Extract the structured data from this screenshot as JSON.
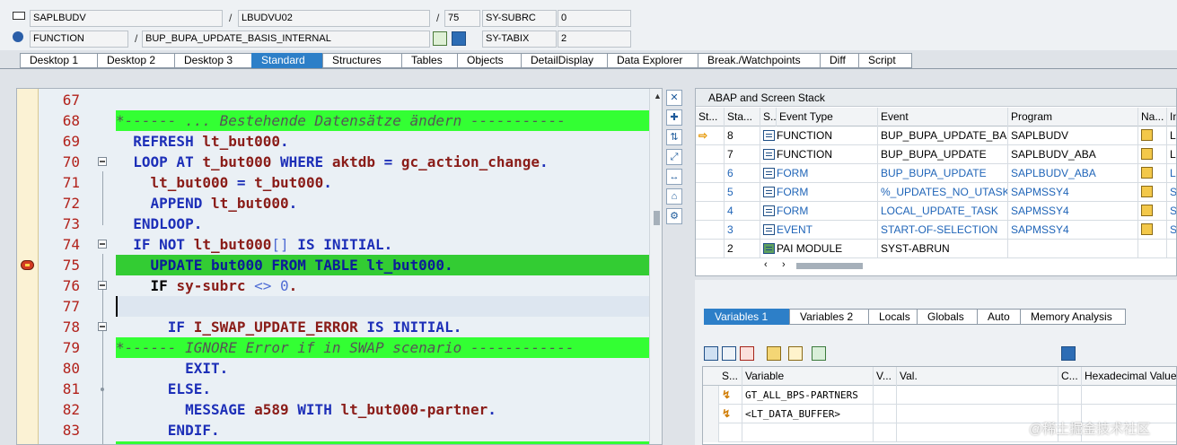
{
  "header": {
    "program": "SAPLBUDV",
    "include": "LBUDVU02",
    "line": "75",
    "subrc_label": "SY-SUBRC",
    "subrc_value": "0",
    "event_type": "FUNCTION",
    "event": "BUP_BUPA_UPDATE_BASIS_INTERNAL",
    "tabix_label": "SY-TABIX",
    "tabix_value": "2",
    "sep": "/"
  },
  "desktop_tabs": [
    "Desktop 1",
    "Desktop 2",
    "Desktop 3",
    "Standard",
    "Structures",
    "Tables",
    "Objects",
    "DetailDisplay",
    "Data Explorer",
    "Break./Watchpoints",
    "Diff",
    "Script"
  ],
  "desktop_tabs_active": "Standard",
  "source": {
    "lines": [
      {
        "no": "67"
      },
      {
        "no": "68",
        "text": "*------ ... Bestehende Datensätze ändern -----------"
      },
      {
        "no": "69",
        "kw1": "REFRESH ",
        "var1": "lt_but000",
        "kw2": "."
      },
      {
        "no": "70",
        "kw1": "LOOP AT ",
        "var1": "t_but000",
        "kw2": " WHERE ",
        "var2": "aktdb",
        "kw3": " = ",
        "var3": "gc_action_change",
        "kw4": "."
      },
      {
        "no": "71",
        "var1": "lt_but000",
        "kw2": " = ",
        "var2": "t_but000",
        "kw3": "."
      },
      {
        "no": "72",
        "kw1": "APPEND ",
        "var1": "lt_but000",
        "kw2": "."
      },
      {
        "no": "73",
        "kw1": "ENDLOOP."
      },
      {
        "no": "74",
        "kw1": "IF NOT ",
        "var1": "lt_but000",
        "n1": "[]",
        "kw2": " IS INITIAL."
      },
      {
        "no": "75",
        "text": "UPDATE but000 FROM TABLE lt_but000."
      },
      {
        "no": "76",
        "kw1": "IF ",
        "var1": "sy-subrc",
        "kw2": " <> ",
        "n1": "0",
        "kw3": "."
      },
      {
        "no": "77"
      },
      {
        "no": "78",
        "kw1": "IF ",
        "var1": "I_SWAP_UPDATE_ERROR",
        "kw2": " IS INITIAL."
      },
      {
        "no": "79",
        "text": "*------ IGNORE Error if in SWAP scenario ------------"
      },
      {
        "no": "80",
        "kw1": "EXIT."
      },
      {
        "no": "81",
        "kw1": "ELSE."
      },
      {
        "no": "82",
        "kw1": "MESSAGE ",
        "var1": "a589",
        "kw2": " WITH ",
        "var2": "lt_but000-partner",
        "kw3": "."
      },
      {
        "no": "83",
        "kw1": "ENDIF."
      }
    ]
  },
  "stack": {
    "title": "ABAP and Screen Stack",
    "columns": [
      "St...",
      "Sta...",
      "S...",
      "Event Type",
      "Event",
      "Program",
      "Na...",
      "In"
    ],
    "rows": [
      {
        "current": true,
        "level": "8",
        "event_type": "FUNCTION",
        "event": "BUP_BUPA_UPDATE_BA...",
        "program": "SAPLBUDV",
        "include": "LE",
        "link": false
      },
      {
        "current": false,
        "level": "7",
        "event_type": "FUNCTION",
        "event": "BUP_BUPA_UPDATE",
        "program": "SAPLBUDV_ABA",
        "include": "LE",
        "link": false
      },
      {
        "current": false,
        "level": "6",
        "event_type": "FORM",
        "event": "BUP_BUPA_UPDATE",
        "program": "SAPLBUDV_ABA",
        "include": "LE",
        "link": true
      },
      {
        "current": false,
        "level": "5",
        "event_type": "FORM",
        "event": "%_UPDATES_NO_UTASK",
        "program": "SAPMSSY4",
        "include": "SA",
        "link": true
      },
      {
        "current": false,
        "level": "4",
        "event_type": "FORM",
        "event": "LOCAL_UPDATE_TASK",
        "program": "SAPMSSY4",
        "include": "SA",
        "link": true
      },
      {
        "current": false,
        "level": "3",
        "event_type": "EVENT",
        "event": "START-OF-SELECTION",
        "program": "SAPMSSY4",
        "include": "SA",
        "link": true
      },
      {
        "current": false,
        "level": "2",
        "event_type": "PAI MODULE",
        "event": "SYST-ABRUN",
        "program": "",
        "include": "",
        "link": false
      }
    ]
  },
  "variables": {
    "tabs": [
      "Variables 1",
      "Variables 2",
      "Locals",
      "Globals",
      "Auto",
      "Memory Analysis"
    ],
    "active": "Variables 1",
    "columns": [
      "S...",
      "Variable",
      "V...",
      "Val.",
      "C...",
      "Hexadecimal Value"
    ],
    "rows": [
      {
        "name": "GT_ALL_BPS-PARTNERS",
        "value": "",
        "hex": ""
      },
      {
        "name": "<LT_DATA_BUFFER>",
        "value": "",
        "hex": ""
      }
    ]
  },
  "watermark": "@稀土掘金技术社区",
  "colors": {
    "accent": "#2d7fc8",
    "current_line": "#33cc33",
    "comment_line": "#33ff33",
    "line_number": "#b2221b",
    "keyword": "#1d2fb8",
    "variable": "#8a1c18"
  }
}
